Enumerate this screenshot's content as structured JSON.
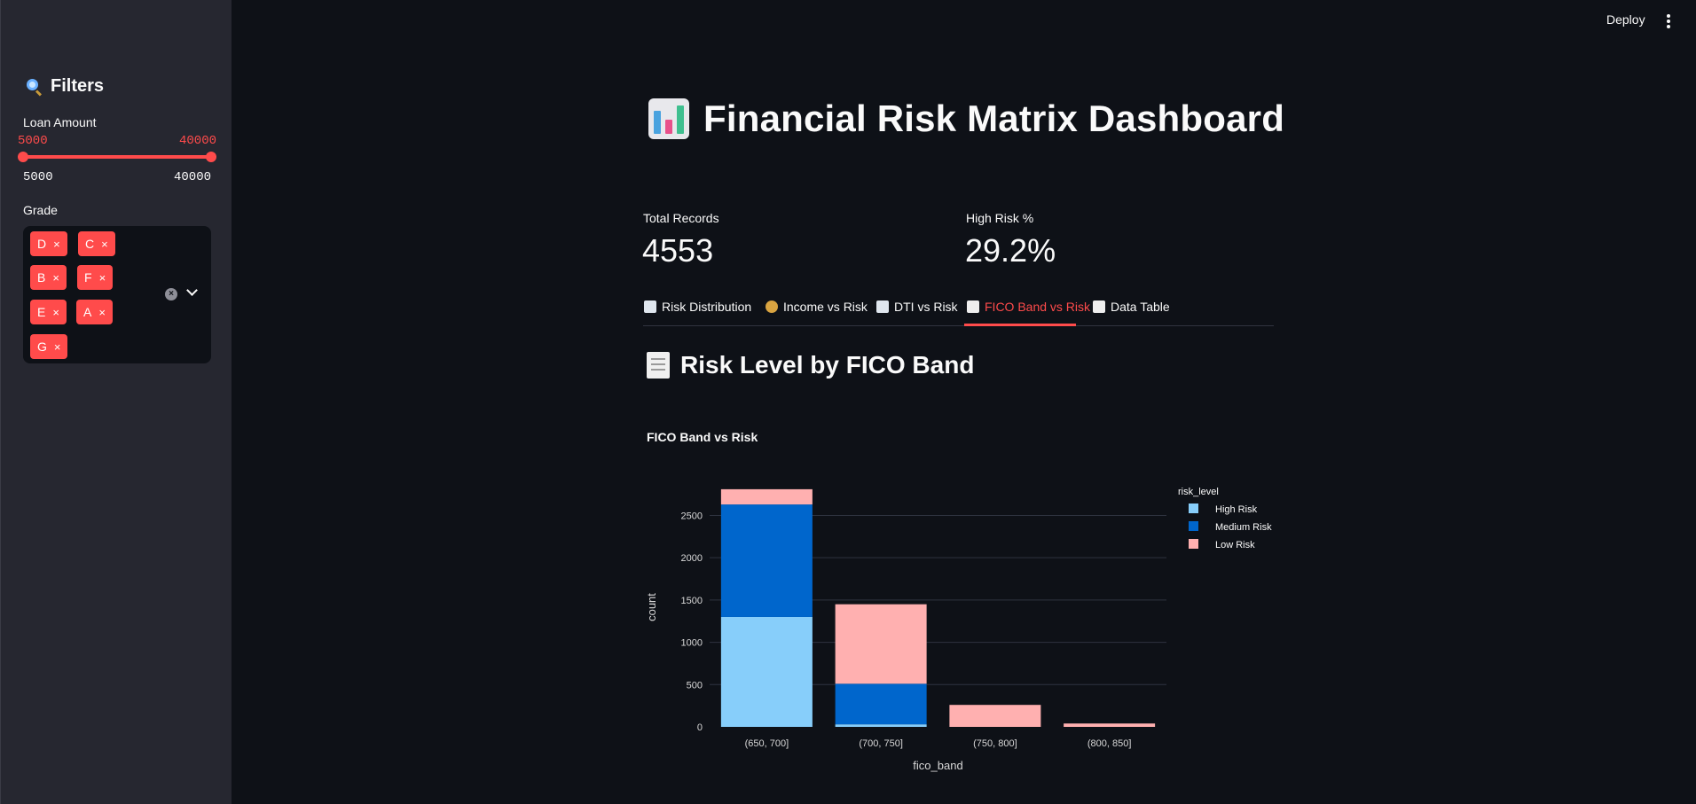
{
  "sidebar": {
    "filters_title": "Filters",
    "loan_amount": {
      "label": "Loan Amount",
      "selected_min": "5000",
      "selected_max": "40000",
      "range_min": "5000",
      "range_max": "40000",
      "accent_color": "#ff4b4b"
    },
    "grade": {
      "label": "Grade",
      "chips": [
        "D",
        "C",
        "B",
        "F",
        "E",
        "A",
        "G"
      ],
      "chip_close": "×"
    }
  },
  "header": {
    "deploy_label": "Deploy"
  },
  "main": {
    "title": "Financial Risk Matrix Dashboard",
    "metrics": [
      {
        "label": "Total Records",
        "value": "4553"
      },
      {
        "label": "High Risk %",
        "value": "29.2%"
      }
    ],
    "tabs": [
      {
        "label": "Risk Distribution",
        "icon": "bar-chart-icon"
      },
      {
        "label": "Income vs Risk",
        "icon": "money-bag-icon"
      },
      {
        "label": "DTI vs Risk",
        "icon": "line-chart-icon"
      },
      {
        "label": "FICO Band vs Risk",
        "icon": "receipt-icon",
        "active": true
      },
      {
        "label": "Data Table",
        "icon": "document-icon"
      }
    ],
    "section_title": "Risk Level by FICO Band"
  },
  "chart_data": {
    "type": "bar",
    "stacked": true,
    "title": "FICO Band vs Risk",
    "xlabel": "fico_band",
    "ylabel": "count",
    "categories": [
      "(650, 700]",
      "(700, 750]",
      "(750, 800]",
      "(800, 850]"
    ],
    "series": [
      {
        "name": "High Risk",
        "color": "#87cefa",
        "values": [
          1300,
          30,
          0,
          0
        ]
      },
      {
        "name": "Medium Risk",
        "color": "#0066cc",
        "values": [
          1330,
          480,
          0,
          0
        ]
      },
      {
        "name": "Low Risk",
        "color": "#ffb0b0",
        "values": [
          180,
          940,
          260,
          40
        ]
      }
    ],
    "legend_title": "risk_level",
    "legend_position": "top-right",
    "yticks": [
      0,
      500,
      1000,
      1500,
      2000,
      2500
    ],
    "ylim": [
      0,
      2830
    ],
    "grid": true
  }
}
